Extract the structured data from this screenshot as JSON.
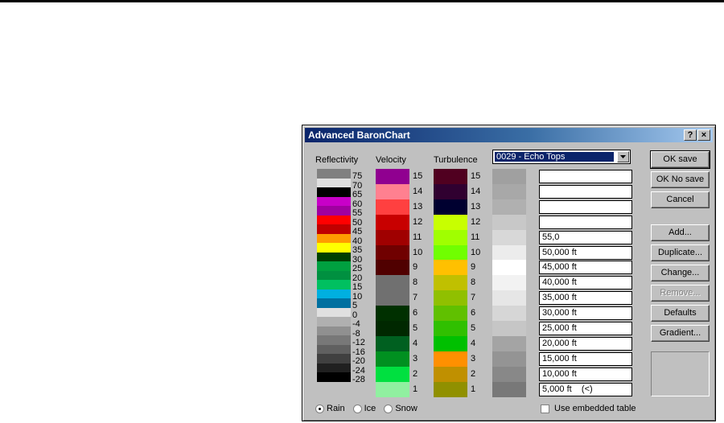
{
  "window": {
    "title": "Advanced BaronChart",
    "help_button": "?",
    "close_button": "×"
  },
  "columns": {
    "reflectivity": {
      "label": "Reflectivity",
      "colors": [
        "#808080",
        "#e0e0e0",
        "#000000",
        "#c800c8",
        "#a000a0",
        "#ff0000",
        "#c00000",
        "#ff9c00",
        "#ffff00",
        "#004000",
        "#00a040",
        "#009040",
        "#00c060",
        "#00b0e0",
        "#0070a0",
        "#e0e0e0",
        "#b0b0b0",
        "#909090",
        "#787878",
        "#606060",
        "#404040",
        "#202020",
        "#000000"
      ],
      "labels": [
        "75",
        "70",
        "65",
        "60",
        "55",
        "50",
        "45",
        "40",
        "35",
        "30",
        "25",
        "20",
        "15",
        "10",
        "5",
        "0",
        "-4",
        "-8",
        "-12",
        "-16",
        "-20",
        "-24",
        "-28"
      ]
    },
    "velocity": {
      "label": "Velocity",
      "colors": [
        "#900090",
        "#ff8090",
        "#ff4040",
        "#c80000",
        "#a00000",
        "#700000",
        "#500000",
        "#707070",
        "#707070",
        "#003000",
        "#002800",
        "#006020",
        "#009020",
        "#00e040",
        "#90f0a0"
      ],
      "labels": [
        "15",
        "14",
        "13",
        "12",
        "11",
        "10",
        "9",
        "8",
        "7",
        "6",
        "5",
        "4",
        "3",
        "2",
        "1"
      ]
    },
    "turbulence": {
      "label": "Turbulence",
      "colors": [
        "#500020",
        "#300030",
        "#000030",
        "#c8ff00",
        "#a0ff00",
        "#70ff00",
        "#ffc000",
        "#c0c000",
        "#90c000",
        "#60c000",
        "#30c000",
        "#00c000",
        "#ff9000",
        "#c09000",
        "#909000"
      ],
      "labels": [
        "15",
        "14",
        "13",
        "12",
        "11",
        "10",
        "9",
        "8",
        "7",
        "6",
        "5",
        "4",
        "3",
        "2",
        "1"
      ]
    },
    "echo_tops": {
      "dropdown_value": "0029 - Echo Tops",
      "colors": [
        "#a0a0a0",
        "#a8a8a8",
        "#b0b0b0",
        "#c8c8c8",
        "#d8d8d8",
        "#ececec",
        "#ffffff",
        "#f2f2f2",
        "#e6e6e6",
        "#d6d6d6",
        "#c6c6c6",
        "#a4a4a4",
        "#949494",
        "#888888",
        "#787878"
      ],
      "values": [
        "",
        "",
        "",
        "",
        "55,0",
        "50,000 ft",
        "45,000 ft",
        "40,000 ft",
        "35,000 ft",
        "30,000 ft",
        "25,000 ft",
        "20,000 ft",
        "15,000 ft",
        "10,000 ft",
        "5,000 ft    (<)"
      ]
    }
  },
  "buttons": {
    "ok_save": "OK save",
    "ok_no_save": "OK No save",
    "cancel": "Cancel",
    "add": "Add...",
    "duplicate": "Duplicate...",
    "change": "Change...",
    "remove": "Remove...",
    "defaults": "Defaults",
    "gradient": "Gradient..."
  },
  "radios": [
    {
      "label": "Rain",
      "checked": true
    },
    {
      "label": "Ice",
      "checked": false
    },
    {
      "label": "Snow",
      "checked": false
    }
  ],
  "checkbox": {
    "label": "Use embedded table",
    "checked": false
  }
}
